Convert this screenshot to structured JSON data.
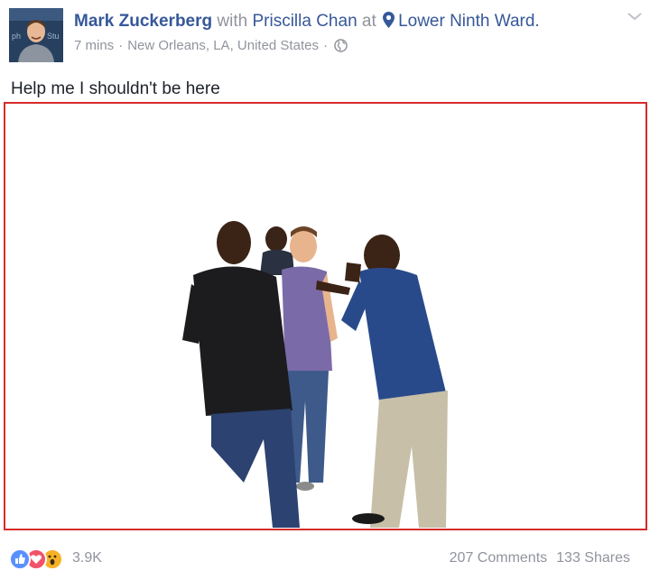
{
  "post": {
    "author": "Mark Zuckerberg",
    "with_word": "with",
    "tagged_person": "Priscilla Chan",
    "at_word": "at",
    "location": "Lower Ninth Ward.",
    "time": "7 mins",
    "separator": "·",
    "place": "New Orleans, LA, United States",
    "audience_icon": "globe-icon",
    "text": "Help me I shouldn't be here"
  },
  "avatar": {
    "icon": "profile-photo"
  },
  "footer": {
    "reactions": [
      "like",
      "love",
      "wow"
    ],
    "reaction_count": "3.9K",
    "comments": "207 Comments",
    "shares": "133 Shares"
  },
  "colors": {
    "link": "#365899",
    "muted": "#90949c",
    "photo_border": "#d62b2b",
    "like": "#5890ff",
    "love": "#f25268",
    "wow": "#f7b125"
  }
}
